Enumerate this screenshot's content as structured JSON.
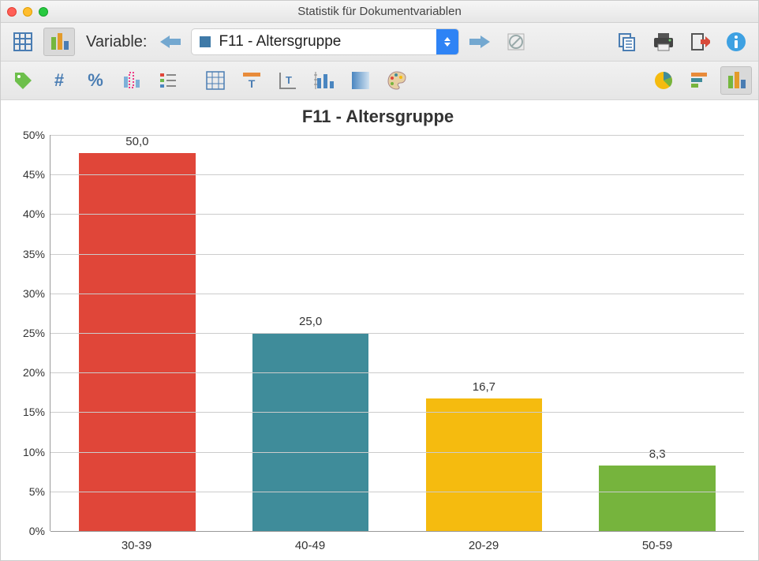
{
  "window_title": "Statistik für Dokumentvariablen",
  "toolbar1": {
    "variable_label": "Variable:"
  },
  "dropdown": {
    "text": "F11 - Altersgruppe"
  },
  "chart_data": {
    "type": "bar",
    "title": "F11 - Altersgruppe",
    "xlabel": "",
    "ylabel": "",
    "ylim": [
      0,
      50
    ],
    "ytick_step": 5,
    "yticks": [
      "0%",
      "5%",
      "10%",
      "15%",
      "20%",
      "25%",
      "30%",
      "35%",
      "40%",
      "45%",
      "50%"
    ],
    "categories": [
      "30-39",
      "40-49",
      "20-29",
      "50-59"
    ],
    "values": [
      50.0,
      25.0,
      16.7,
      8.3
    ],
    "value_labels": [
      "50,0",
      "25,0",
      "16,7",
      "8,3"
    ],
    "colors": [
      "#e04639",
      "#3f8c9a",
      "#f5bb0f",
      "#76b43d"
    ]
  }
}
